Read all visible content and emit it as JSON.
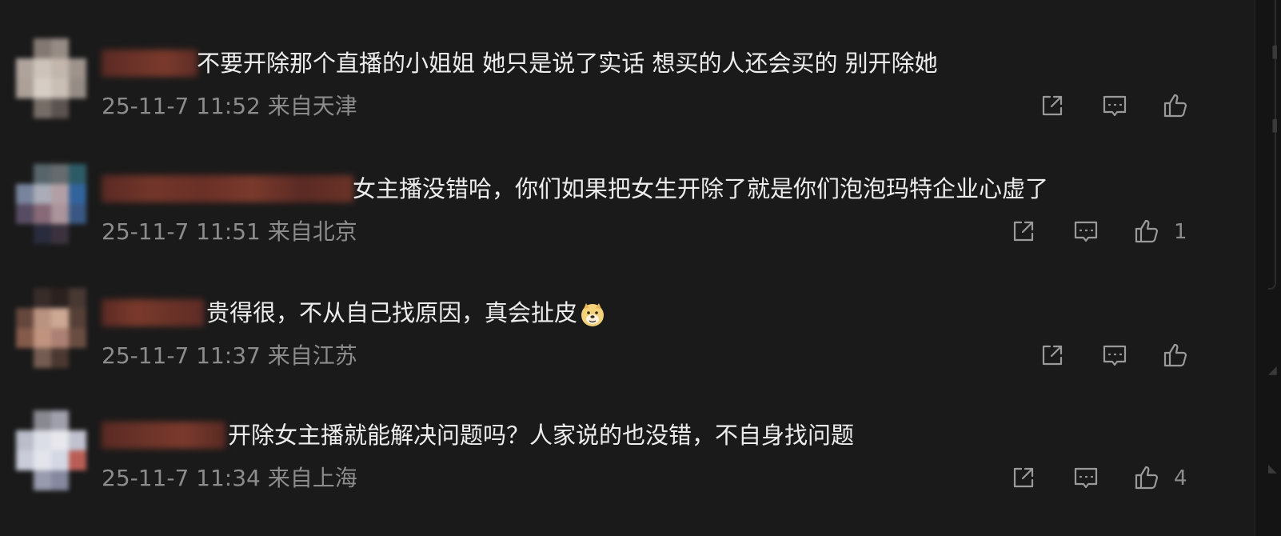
{
  "comments": [
    {
      "text": "不要开除那个直播的小姐姐 她只是说了实话 想买的人还会买的 别开除她",
      "time": "25-11-7 11:52",
      "location": "来自天津",
      "meta": "25-11-7 11:52 来自天津",
      "like_count": "",
      "has_emoji": false
    },
    {
      "text": "女主播没错哈，你们如果把女生开除了就是你们泡泡玛特企业心虚了",
      "time": "25-11-7 11:51",
      "location": "来自北京",
      "meta": "25-11-7 11:51 来自北京",
      "like_count": "1",
      "has_emoji": false
    },
    {
      "text": "贵得很，不从自己找原因，真会扯皮",
      "time": "25-11-7 11:37",
      "location": "来自江苏",
      "meta": "25-11-7 11:37 来自江苏",
      "like_count": "",
      "has_emoji": true,
      "emoji": "doge-emoji"
    },
    {
      "text": "开除女主播就能解决问题吗？人家说的也没错，不自身找问题",
      "time": "25-11-7 11:34",
      "location": "来自上海",
      "meta": "25-11-7 11:34 来自上海",
      "like_count": "4",
      "has_emoji": false
    }
  ],
  "icons": {
    "share": "share-icon",
    "reply": "comment-icon",
    "like": "thumbs-up-icon"
  },
  "colors": {
    "background": "#1a1a1a",
    "text": "#ededed",
    "meta": "#8c8c8c",
    "icon": "#9a9a9a"
  }
}
